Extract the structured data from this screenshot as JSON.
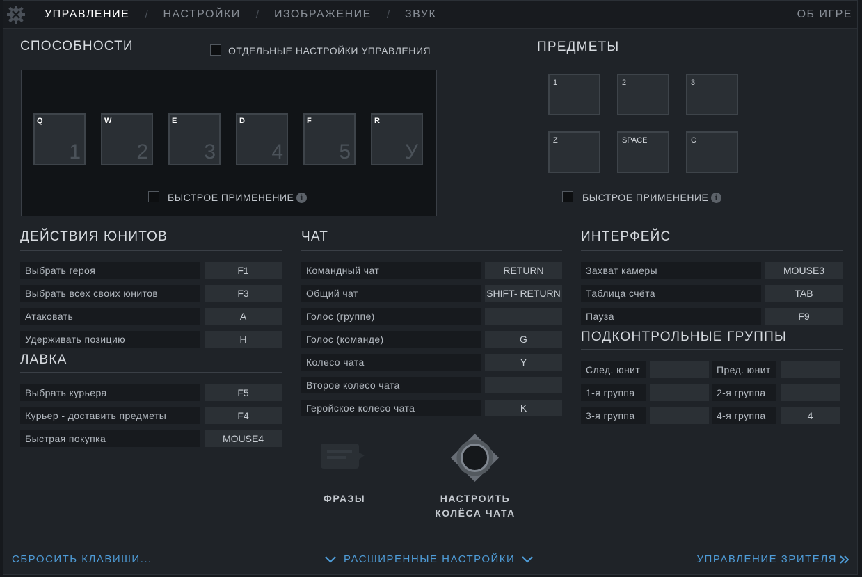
{
  "nav": {
    "tabs": [
      "УПРАВЛЕНИЕ",
      "НАСТРОЙКИ",
      "ИЗОБРАЖЕНИЕ",
      "ЗВУК"
    ],
    "separator": "/",
    "about": "ОБ ИГРЕ"
  },
  "abilities": {
    "title": "СПОСОБНОСТИ",
    "separate_settings_label": "ОТДЕЛЬНЫЕ НАСТРОЙКИ УПРАВЛЕНИЯ",
    "slots": [
      {
        "key": "Q",
        "num": "1"
      },
      {
        "key": "W",
        "num": "2"
      },
      {
        "key": "E",
        "num": "3"
      },
      {
        "key": "D",
        "num": "4"
      },
      {
        "key": "F",
        "num": "5"
      },
      {
        "key": "R",
        "num": "У"
      }
    ],
    "quick_cast_label": "БЫСТРОЕ ПРИМЕНЕНИЕ",
    "info": "i"
  },
  "items": {
    "title": "ПРЕДМЕТЫ",
    "slots": [
      "1",
      "2",
      "3",
      "Z",
      "SPACE",
      "C"
    ],
    "quick_cast_label": "БЫСТРОЕ ПРИМЕНЕНИЕ",
    "info": "i"
  },
  "unit_actions": {
    "title": "ДЕЙСТВИЯ ЮНИТОВ",
    "rows": [
      {
        "label": "Выбрать героя",
        "key": "F1"
      },
      {
        "label": "Выбрать всех своих юнитов",
        "key": "F3"
      },
      {
        "label": "Атаковать",
        "key": "A"
      },
      {
        "label": "Удерживать позицию",
        "key": "H"
      }
    ]
  },
  "shop": {
    "title": "ЛАВКА",
    "rows": [
      {
        "label": "Выбрать курьера",
        "key": "F5"
      },
      {
        "label": "Курьер - доставить предметы",
        "key": "F4"
      },
      {
        "label": "Быстрая покупка",
        "key": "MOUSE4"
      }
    ]
  },
  "chat": {
    "title": "ЧАТ",
    "rows": [
      {
        "label": "Командный чат",
        "key": "RETURN"
      },
      {
        "label": "Общий чат",
        "key": "SHIFT- RETURN"
      },
      {
        "label": "Голос (группе)",
        "key": ""
      },
      {
        "label": "Голос (команде)",
        "key": "G"
      },
      {
        "label": "Колесо чата",
        "key": "Y"
      },
      {
        "label": "Второе колесо чата",
        "key": ""
      },
      {
        "label": "Геройское колесо чата",
        "key": "K"
      }
    ],
    "phrases_label": "ФРАЗЫ",
    "wheel_label_1": "НАСТРОИТЬ",
    "wheel_label_2": "КОЛЁСА ЧАТА"
  },
  "interface": {
    "title": "ИНТЕРФЕЙС",
    "rows": [
      {
        "label": "Захват камеры",
        "key": "MOUSE3"
      },
      {
        "label": "Таблица счёта",
        "key": "TAB"
      },
      {
        "label": "Пауза",
        "key": "F9"
      }
    ]
  },
  "control_groups": {
    "title": "ПОДКОНТРОЛЬНЫЕ ГРУППЫ",
    "rows": [
      [
        {
          "label": "След. юнит",
          "key": ""
        },
        {
          "label": "Пред. юнит",
          "key": ""
        }
      ],
      [
        {
          "label": "1-я группа",
          "key": ""
        },
        {
          "label": "2-я группа",
          "key": ""
        }
      ],
      [
        {
          "label": "3-я группа",
          "key": ""
        },
        {
          "label": "4-я группа",
          "key": "4"
        }
      ]
    ]
  },
  "footer": {
    "reset": "СБРОСИТЬ КЛАВИШИ...",
    "advanced": "РАСШИРЕННЫЕ НАСТРОЙКИ",
    "spectator": "УПРАВЛЕНИЕ ЗРИТЕЛЯ"
  },
  "colors": {
    "background": "#1f2328",
    "accent_link": "#4e9bd6"
  }
}
